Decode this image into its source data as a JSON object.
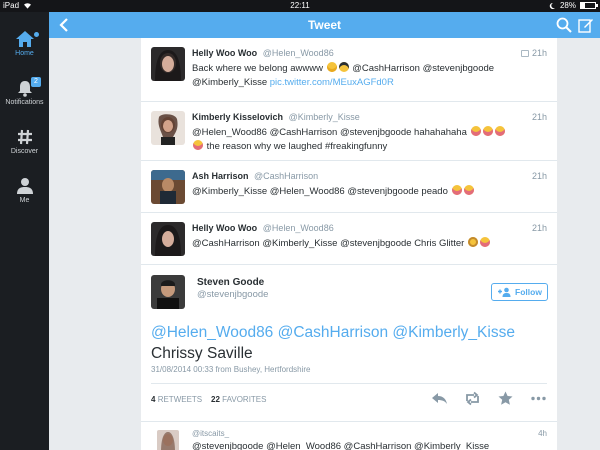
{
  "status_bar": {
    "device": "iPad",
    "time": "22:11",
    "battery": "28%",
    "battery_level": 0.28
  },
  "sidebar": {
    "items": [
      {
        "label": "Home",
        "icon": "home-icon",
        "active": true
      },
      {
        "label": "Notifications",
        "icon": "bell-icon",
        "badge": "2"
      },
      {
        "label": "Discover",
        "icon": "hashtag-icon"
      },
      {
        "label": "Me",
        "icon": "person-icon"
      }
    ]
  },
  "header": {
    "title": "Tweet",
    "back_icon": "back-icon",
    "search_icon": "search-icon",
    "compose_icon": "compose-icon"
  },
  "colors": {
    "accent": "#55acee",
    "sidebar": "#1b1e22",
    "background": "#e8ebee"
  },
  "tweets": [
    {
      "name": "Helly Woo Woo",
      "handle": "@Helen_Wood86",
      "time": "21h",
      "text_a": "Back where we belong awwww",
      "text_b": "@CashHarrison @stevenjbgoode",
      "text_c": "@Kimberly_Kisse",
      "link": "pic.twitter.com/MEuxAGFd0R"
    },
    {
      "name": "Kimberly Kisselovich",
      "handle": "@Kimberly_Kisse",
      "time": "21h",
      "text_a": "@Helen_Wood86 @CashHarrison @stevenjbgoode hahahahaha",
      "text_b": "the reason why we laughed #freakingfunny"
    },
    {
      "name": "Ash Harrison",
      "handle": "@CashHarrison",
      "time": "21h",
      "text_a": "@Kimberly_Kisse @Helen_Wood86 @stevenjbgoode peado"
    },
    {
      "name": "Helly Woo Woo",
      "handle": "@Helen_Wood86",
      "time": "21h",
      "text_a": "@CashHarrison @Kimberly_Kisse @stevenjbgoode Chris Glitter"
    }
  ],
  "detail": {
    "name": "Steven Goode",
    "handle": "@stevenjbgoode",
    "follow_label": "Follow",
    "mentions": "@Helen_Wood86 @CashHarrison @Kimberly_Kisse",
    "text": "Chrissy Saville",
    "meta": "31/08/2014 00:33 from Bushey, Hertfordshire",
    "retweets_count": "4",
    "retweets_label": "RETWEETS",
    "favorites_count": "22",
    "favorites_label": "FAVORITES",
    "actions": [
      "reply-icon",
      "retweet-icon",
      "favorite-icon",
      "more-icon"
    ]
  },
  "reply": {
    "handle": "@itscaits_",
    "time": "4h",
    "text": "@stevenjbgoode @Helen_Wood86 @CashHarrison @Kimberly_Kisse"
  }
}
